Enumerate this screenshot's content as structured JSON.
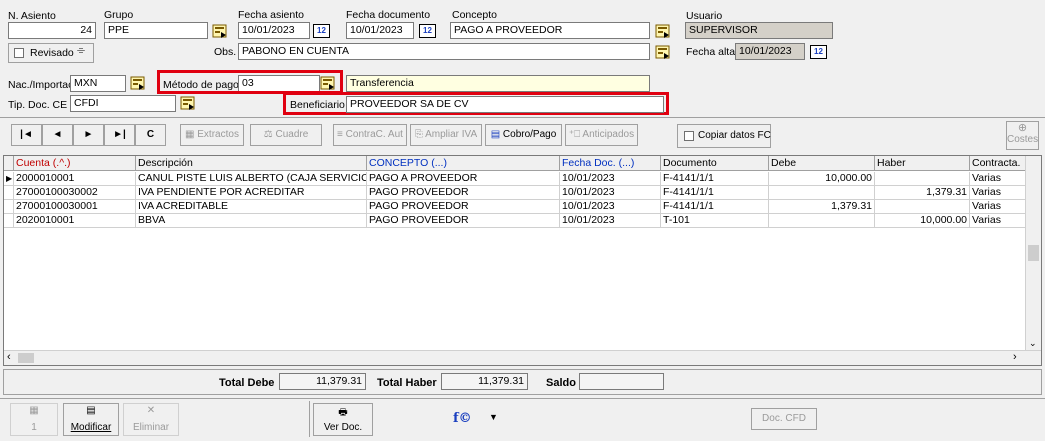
{
  "header": {
    "n_asiento": {
      "label": "N. Asiento",
      "value": "24"
    },
    "grupo": {
      "label": "Grupo",
      "value": "PPE"
    },
    "fecha_asiento": {
      "label": "Fecha asiento",
      "value": "10/01/2023"
    },
    "fecha_documento": {
      "label": "Fecha documento",
      "value": "10/01/2023"
    },
    "concepto": {
      "label": "Concepto",
      "value": "PAGO A PROVEEDOR"
    },
    "usuario": {
      "label": "Usuario",
      "value": "SUPERVISOR"
    },
    "revisado": {
      "label": "Revisado"
    },
    "obs": {
      "label": "Obs.",
      "value": "PABONO EN CUENTA"
    },
    "fecha_alta": {
      "label": "Fecha alta",
      "value": "10/01/2023"
    },
    "nac_importac": {
      "label": "Nac./Importac",
      "value": "MXN"
    },
    "metodo_pago": {
      "label": "Método de pago",
      "value": "03",
      "desc": "Transferencia"
    },
    "tip_doc_ce": {
      "label": "Tip. Doc. CE",
      "value": "CFDI"
    },
    "beneficiario": {
      "label": "Beneficiario",
      "value": "PROVEEDOR SA DE CV"
    },
    "calendar_glyph": "12"
  },
  "toolbar": {
    "first": "|◄",
    "prev": "◄",
    "next": "►",
    "last": "►|",
    "refresh": "C",
    "extractos": "Extractos",
    "cuadre": "Cuadre",
    "contrac_aut": "ContraC. Aut",
    "ampliar_iva": "Ampliar IVA",
    "cobro_pago": "Cobro/Pago",
    "anticipados": "Anticipados",
    "copiar_datos_fc": "Copiar datos FC",
    "costes": "Costes"
  },
  "grid": {
    "columns": [
      "Cuenta (.^.)",
      "Descripción",
      "CONCEPTO (...)",
      "Fecha Doc. (...)",
      "Documento",
      "Debe",
      "Haber",
      "Contracta."
    ],
    "rows": [
      {
        "cuenta": "2000010001",
        "descripcion": "CANUL PISTE LUIS  ALBERTO (CAJA SERVICIO)",
        "concepto": "PAGO A PROVEEDOR",
        "fecha": "10/01/2023",
        "documento": "F-4141/1/1",
        "debe": "10,000.00",
        "haber": "",
        "contracta": "Varias"
      },
      {
        "cuenta": "27000100030002",
        "descripcion": "IVA PENDIENTE POR ACREDITAR",
        "concepto": "PAGO PROVEEDOR",
        "fecha": "10/01/2023",
        "documento": "F-4141/1/1",
        "debe": "",
        "haber": "1,379.31",
        "contracta": "Varias"
      },
      {
        "cuenta": "27000100030001",
        "descripcion": "IVA ACREDITABLE",
        "concepto": "PAGO PROVEEDOR",
        "fecha": "10/01/2023",
        "documento": "F-4141/1/1",
        "debe": "1,379.31",
        "haber": "",
        "contracta": "Varias"
      },
      {
        "cuenta": "2020010001",
        "descripcion": "BBVA",
        "concepto": "PAGO PROVEEDOR",
        "fecha": "10/01/2023",
        "documento": "T-101",
        "debe": "",
        "haber": "10,000.00",
        "contracta": "Varias"
      }
    ]
  },
  "totals": {
    "total_debe_label": "Total Debe",
    "total_debe": "11,379.31",
    "total_haber_label": "Total Haber",
    "total_haber": "11,379.31",
    "saldo_label": "Saldo",
    "saldo": ""
  },
  "bottom": {
    "nuevo_num": "1",
    "modificar": "Modificar",
    "eliminar": "Eliminar",
    "ver_doc": "Ver Doc.",
    "fx": "f©",
    "doc_cfd": "Doc. CFD"
  }
}
